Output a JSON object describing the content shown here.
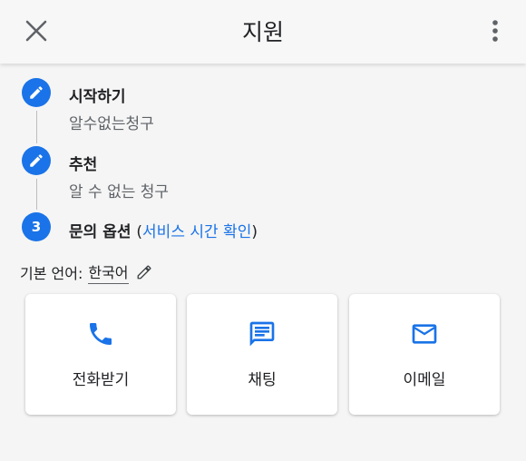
{
  "header": {
    "title": "지원",
    "close_icon": "close-icon",
    "more_icon": "more-vert-icon"
  },
  "steps": [
    {
      "marker": "pencil-icon",
      "title": "시작하기",
      "subtitle": "알수없는청구"
    },
    {
      "marker": "pencil-icon",
      "title": "추천",
      "subtitle": "알 수 없는 청구"
    },
    {
      "marker_number": "3",
      "title": "문의 옵션",
      "paren_open": "(",
      "link": "서비스 시간 확인",
      "paren_close": ")"
    }
  ],
  "language": {
    "label": "기본 언어:",
    "value": "한국어",
    "edit_icon": "pencil-icon"
  },
  "contact_options": [
    {
      "icon": "phone-icon",
      "label": "전화받기"
    },
    {
      "icon": "chat-icon",
      "label": "채팅"
    },
    {
      "icon": "mail-icon",
      "label": "이메일"
    }
  ],
  "colors": {
    "accent": "#1a73e8",
    "background": "#f5f5f5",
    "card": "#ffffff"
  }
}
